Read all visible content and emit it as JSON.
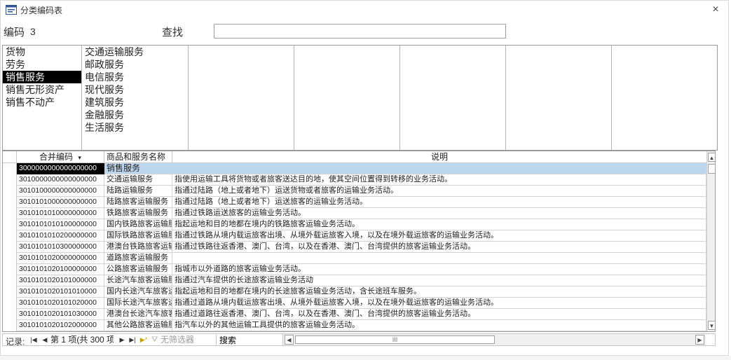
{
  "window": {
    "title": "分类编码表",
    "icon": "form-icon",
    "close_glyph": "×"
  },
  "toolbar": {
    "code_label": "编码",
    "code_value": "3",
    "search_label": "查找",
    "search_value": ""
  },
  "categories": {
    "columns": [
      {
        "items": [
          "货物",
          "劳务",
          "销售服务",
          "销售无形资产",
          "销售不动产"
        ],
        "selected": 2
      },
      {
        "items": [
          "交通运输服务",
          "邮政服务",
          "电信服务",
          "现代服务",
          "建筑服务",
          "金融服务",
          "生活服务"
        ],
        "selected": -1
      },
      {
        "items": [],
        "selected": -1
      },
      {
        "items": [],
        "selected": -1
      },
      {
        "items": [],
        "selected": -1
      },
      {
        "items": [],
        "selected": -1
      },
      {
        "items": [],
        "selected": -1
      }
    ]
  },
  "sheet": {
    "headers": {
      "code": "合并编码",
      "name": "商品和服务名称",
      "desc": "说明"
    },
    "rows": [
      {
        "code": "3000000000000000000",
        "name": "销售服务",
        "desc": ""
      },
      {
        "code": "3010000000000000000",
        "name": "交通运输服务",
        "desc": "指使用运输工具将货物或者旅客送达目的地，使其空间位置得到转移的业务活动。"
      },
      {
        "code": "3010100000000000000",
        "name": "陆路运输服务",
        "desc": "指通过陆路（地上或者地下）运送货物或者旅客的运输业务活动。"
      },
      {
        "code": "3010101000000000000",
        "name": "陆路旅客运输服务",
        "desc": "指通过陆路（地上或者地下）运送旅客的运输业务活动。"
      },
      {
        "code": "3010101010000000000",
        "name": "铁路旅客运输服务",
        "desc": "指通过铁路运送旅客的运输业务活动。"
      },
      {
        "code": "3010101010100000000",
        "name": "国内铁路旅客运输服务",
        "desc": "指起运地和目的地都在境内的铁路旅客运输业务活动。"
      },
      {
        "code": "3010101010200000000",
        "name": "国际铁路旅客运输服务",
        "desc": "指通过铁路从境内载运旅客出境、从境外载运旅客入境，以及在境外载运旅客的运输业务活动。"
      },
      {
        "code": "3010101010300000000",
        "name": "港澳台铁路旅客运输服务",
        "desc": "指通过铁路往返香港、澳门、台湾，以及在香港、澳门、台湾提供的旅客运输业务活动。"
      },
      {
        "code": "3010101020000000000",
        "name": "道路旅客运输服务",
        "desc": ""
      },
      {
        "code": "3010101020100000000",
        "name": "公路旅客运输服务",
        "desc": "指城市以外道路的旅客运输业务活动。"
      },
      {
        "code": "3010101020101000000",
        "name": "长途汽车旅客运输服务",
        "desc": "指通过汽车提供的长途旅客运输业务活动"
      },
      {
        "code": "3010101020101010000",
        "name": "国内长途汽车旅客运输服务",
        "desc": "指起运地和目的地都在境内的长途旅客运输业务活动，含长途班车服务。"
      },
      {
        "code": "3010101020101020000",
        "name": "国际长途汽车旅客运输服务",
        "desc": "指通过道路从境内载运旅客出境、从境外载运旅客入境，以及在境外载运旅客的运输业务活动。"
      },
      {
        "code": "3010101020101030000",
        "name": "港澳台长途汽车旅客运输服务",
        "desc": "指通过道路往返香港、澳门、台湾，以及在香港、澳门、台湾提供的旅客运输业务活动。"
      },
      {
        "code": "3010101020102000000",
        "name": "其他公路旅客运输服务",
        "desc": "指汽车以外的其他运输工具提供的旅客运输业务活动。"
      }
    ],
    "selected_row": 0
  },
  "navbar": {
    "label": "记录:",
    "record_text": "第 1 项(共 300 项)",
    "nofilter_label": "无筛选器",
    "search_value": "搜索",
    "hthumb_grip": "III"
  },
  "colors": {
    "selection": "#000000",
    "row_highlight": "#bdd7ee",
    "border": "#9a9a9a"
  }
}
